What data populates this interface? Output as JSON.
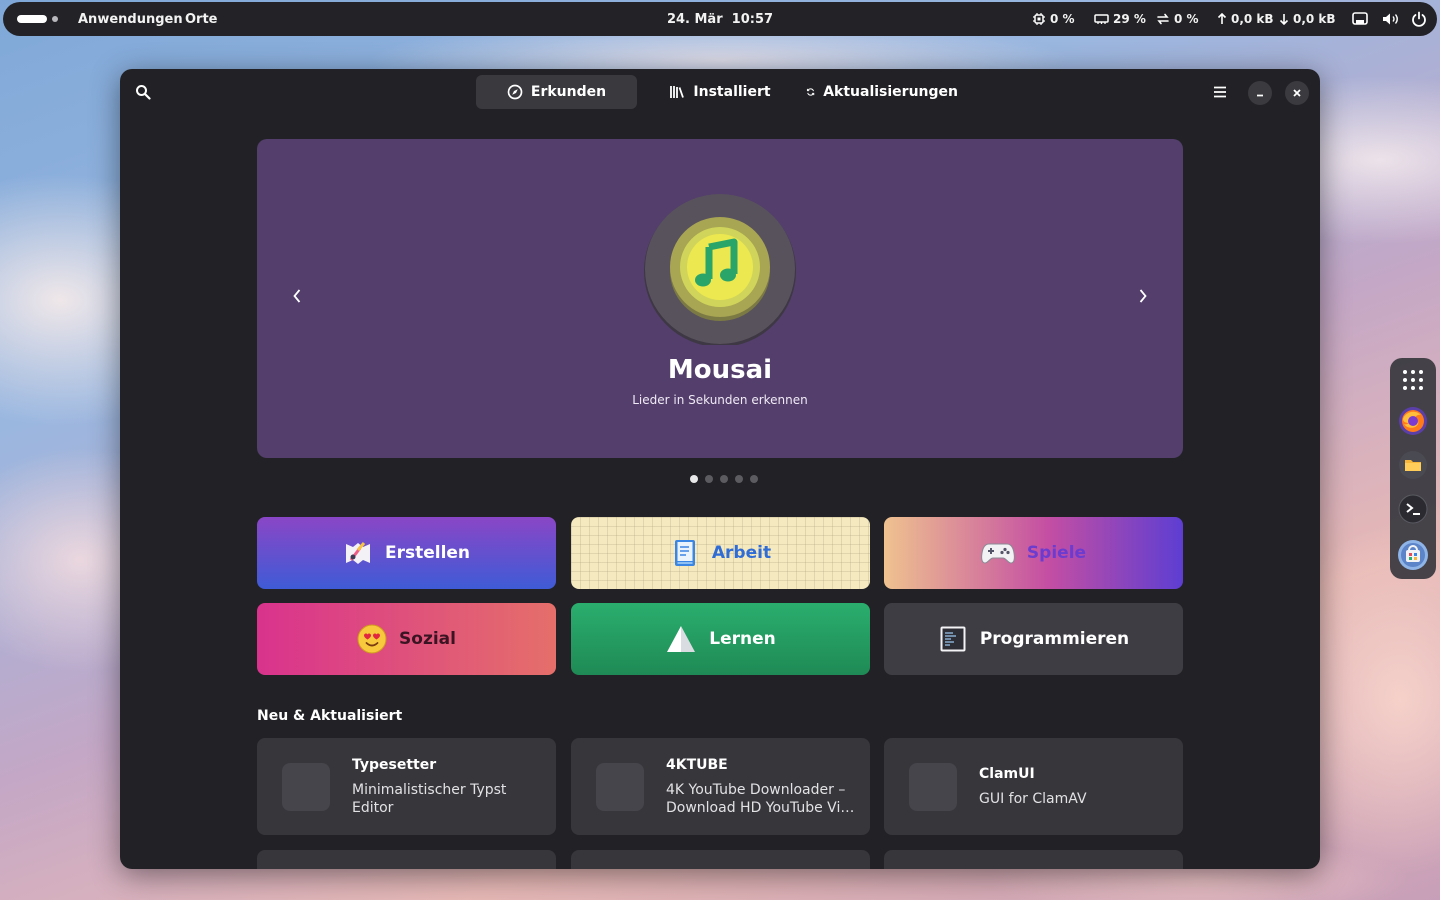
{
  "topbar": {
    "activities": "Anwendungen",
    "places": "Orte",
    "clock": "24. Mär  10:57",
    "cpu": "0 %",
    "memory": "29 %",
    "swap": "0 %",
    "upload": "0,0 kB",
    "download": "0,0 kB"
  },
  "window": {
    "tabs": [
      {
        "label": "Erkunden",
        "icon": "compass-icon"
      },
      {
        "label": "Installiert",
        "icon": "library-icon"
      },
      {
        "label": "Aktualisierungen",
        "icon": "refresh-icon"
      }
    ]
  },
  "banner": {
    "title": "Mousai",
    "subtitle": "Lieder in Sekunden erkennen",
    "page_count": 5,
    "active_page": 0,
    "color": "#533e6c"
  },
  "categories": [
    {
      "label": "Erstellen",
      "icon": "create-icon"
    },
    {
      "label": "Arbeit",
      "icon": "work-icon"
    },
    {
      "label": "Spiele",
      "icon": "gamepad-icon"
    },
    {
      "label": "Sozial",
      "icon": "heart-eyes-icon"
    },
    {
      "label": "Lernen",
      "icon": "learn-icon"
    },
    {
      "label": "Programmieren",
      "icon": "terminal-icon"
    }
  ],
  "section": {
    "title": "Neu & Aktualisiert",
    "apps": [
      {
        "name": "Typesetter",
        "desc_line1": "Minimalistischer Typst",
        "desc_line2": "Editor"
      },
      {
        "name": "4KTUBE",
        "desc_line1": "4K YouTube Downloader –",
        "desc_line2": "Download HD YouTube Vi…"
      },
      {
        "name": "ClamUI",
        "desc_line1": "GUI for ClamAV",
        "desc_line2": ""
      }
    ]
  },
  "dock": {
    "items": [
      "app-grid-icon",
      "firefox-icon",
      "files-icon",
      "terminal-icon",
      "software-icon"
    ]
  }
}
